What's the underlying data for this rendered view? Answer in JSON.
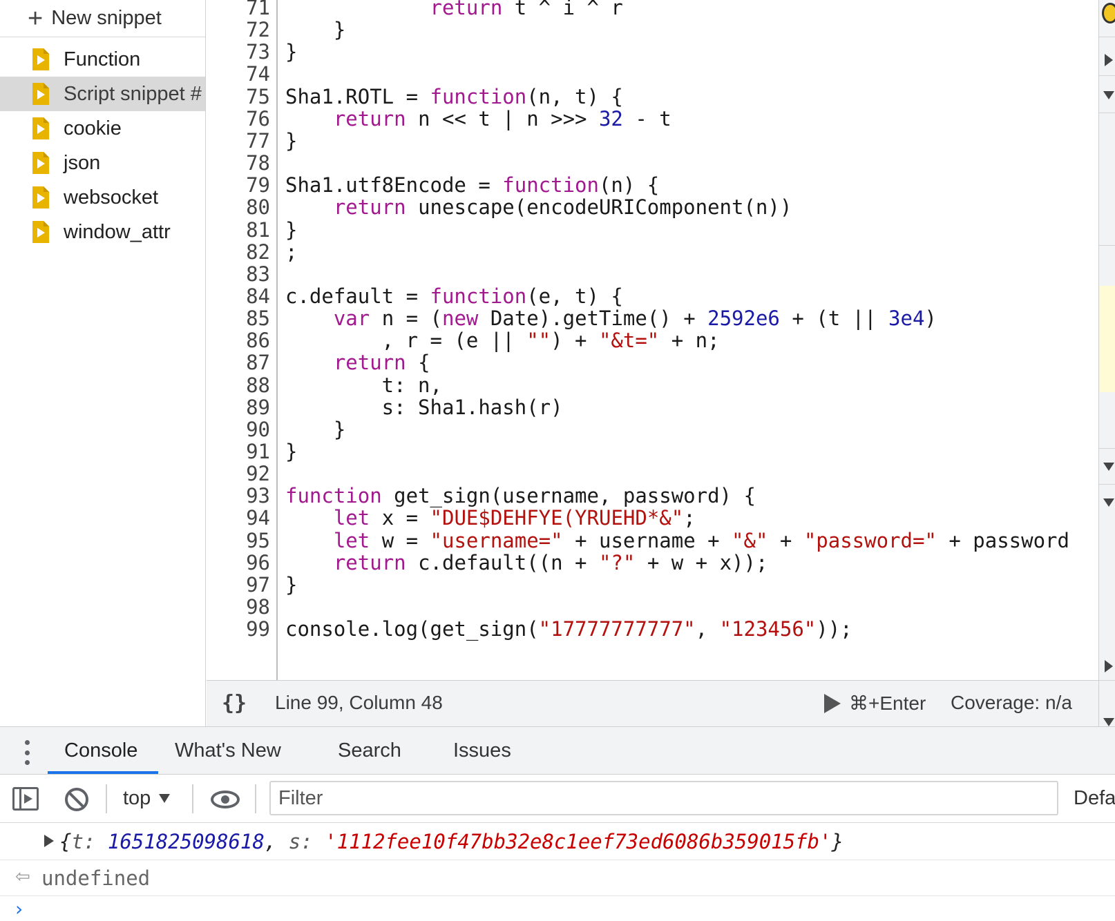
{
  "sidebar": {
    "new_snippet_label": "New snippet",
    "items": [
      {
        "label": "Function"
      },
      {
        "label": "Script snippet #"
      },
      {
        "label": "cookie"
      },
      {
        "label": "json"
      },
      {
        "label": "websocket"
      },
      {
        "label": "window_attr"
      }
    ],
    "selected_index": 1
  },
  "editor": {
    "lines": [
      {
        "n": "71",
        "tokens": [
          {
            "t": "            "
          },
          {
            "t": "return",
            "c": "kw"
          },
          {
            "t": " t ^ i ^ r"
          }
        ]
      },
      {
        "n": "72",
        "tokens": [
          {
            "t": "    }"
          }
        ]
      },
      {
        "n": "73",
        "tokens": [
          {
            "t": "}"
          }
        ]
      },
      {
        "n": "74",
        "tokens": []
      },
      {
        "n": "75",
        "tokens": [
          {
            "t": "Sha1.ROTL = "
          },
          {
            "t": "function",
            "c": "kw"
          },
          {
            "t": "(n, t) {"
          }
        ]
      },
      {
        "n": "76",
        "tokens": [
          {
            "t": "    "
          },
          {
            "t": "return",
            "c": "kw"
          },
          {
            "t": " n << t | n >>> "
          },
          {
            "t": "32",
            "c": "num"
          },
          {
            "t": " - t"
          }
        ]
      },
      {
        "n": "77",
        "tokens": [
          {
            "t": "}"
          }
        ]
      },
      {
        "n": "78",
        "tokens": []
      },
      {
        "n": "79",
        "tokens": [
          {
            "t": "Sha1.utf8Encode = "
          },
          {
            "t": "function",
            "c": "kw"
          },
          {
            "t": "(n) {"
          }
        ]
      },
      {
        "n": "80",
        "tokens": [
          {
            "t": "    "
          },
          {
            "t": "return",
            "c": "kw"
          },
          {
            "t": " unescape(encodeURIComponent(n))"
          }
        ]
      },
      {
        "n": "81",
        "tokens": [
          {
            "t": "}"
          }
        ]
      },
      {
        "n": "82",
        "tokens": [
          {
            "t": ";"
          }
        ]
      },
      {
        "n": "83",
        "tokens": []
      },
      {
        "n": "84",
        "tokens": [
          {
            "t": "c.default = "
          },
          {
            "t": "function",
            "c": "kw"
          },
          {
            "t": "(e, t) {"
          }
        ]
      },
      {
        "n": "85",
        "tokens": [
          {
            "t": "    "
          },
          {
            "t": "var",
            "c": "kw"
          },
          {
            "t": " n = ("
          },
          {
            "t": "new",
            "c": "kw"
          },
          {
            "t": " Date).getTime() + "
          },
          {
            "t": "2592e6",
            "c": "num"
          },
          {
            "t": " + (t || "
          },
          {
            "t": "3e4",
            "c": "num"
          },
          {
            "t": ")"
          }
        ]
      },
      {
        "n": "86",
        "tokens": [
          {
            "t": "        , r = (e || "
          },
          {
            "t": "\"\"",
            "c": "str"
          },
          {
            "t": ") + "
          },
          {
            "t": "\"&t=\"",
            "c": "str"
          },
          {
            "t": " + n;"
          }
        ]
      },
      {
        "n": "87",
        "tokens": [
          {
            "t": "    "
          },
          {
            "t": "return",
            "c": "kw"
          },
          {
            "t": " {"
          }
        ]
      },
      {
        "n": "88",
        "tokens": [
          {
            "t": "        t: n,"
          }
        ]
      },
      {
        "n": "89",
        "tokens": [
          {
            "t": "        s: Sha1.hash(r)"
          }
        ]
      },
      {
        "n": "90",
        "tokens": [
          {
            "t": "    }"
          }
        ]
      },
      {
        "n": "91",
        "tokens": [
          {
            "t": "}"
          }
        ]
      },
      {
        "n": "92",
        "tokens": []
      },
      {
        "n": "93",
        "tokens": [
          {
            "t": "function",
            "c": "kw"
          },
          {
            "t": " get_sign(username, password) {"
          }
        ]
      },
      {
        "n": "94",
        "tokens": [
          {
            "t": "    "
          },
          {
            "t": "let",
            "c": "kw"
          },
          {
            "t": " x = "
          },
          {
            "t": "\"DUE$DEHFYE(YRUEHD*&\"",
            "c": "str"
          },
          {
            "t": ";"
          }
        ]
      },
      {
        "n": "95",
        "tokens": [
          {
            "t": "    "
          },
          {
            "t": "let",
            "c": "kw"
          },
          {
            "t": " w = "
          },
          {
            "t": "\"username=\"",
            "c": "str"
          },
          {
            "t": " + username + "
          },
          {
            "t": "\"&\"",
            "c": "str"
          },
          {
            "t": " + "
          },
          {
            "t": "\"password=\"",
            "c": "str"
          },
          {
            "t": " + password"
          }
        ]
      },
      {
        "n": "96",
        "tokens": [
          {
            "t": "    "
          },
          {
            "t": "return",
            "c": "kw"
          },
          {
            "t": " c.default((n + "
          },
          {
            "t": "\"?\"",
            "c": "str"
          },
          {
            "t": " + w + x));"
          }
        ]
      },
      {
        "n": "97",
        "tokens": [
          {
            "t": "}"
          }
        ]
      },
      {
        "n": "98",
        "tokens": []
      },
      {
        "n": "99",
        "tokens": [
          {
            "t": "console.log(get_sign("
          },
          {
            "t": "\"17777777777\"",
            "c": "str"
          },
          {
            "t": ", "
          },
          {
            "t": "\"123456\"",
            "c": "str"
          },
          {
            "t": "));"
          }
        ]
      }
    ]
  },
  "status_bar": {
    "braces_icon": "pretty-print-icon",
    "cursor_position": "Line 99, Column 48",
    "run_shortcut": "⌘+Enter",
    "coverage": "Coverage: n/a"
  },
  "drawer": {
    "tabs": [
      {
        "label": "Console",
        "active": true
      },
      {
        "label": "What's New",
        "active": false
      },
      {
        "label": "Search",
        "active": false
      },
      {
        "label": "Issues",
        "active": false
      }
    ],
    "accent_color": "#1a73e8"
  },
  "console": {
    "context": "top",
    "filter_placeholder": "Filter",
    "levels_label": "Defa",
    "output": {
      "open": "{",
      "t_key": "t:",
      "t_value": "1651825098618",
      "sep": ",",
      "s_key": "s:",
      "s_value": "'1112fee10f47bb32e8c1eef73ed6086b359015fb'",
      "close": "}"
    },
    "return_value": "undefined"
  }
}
